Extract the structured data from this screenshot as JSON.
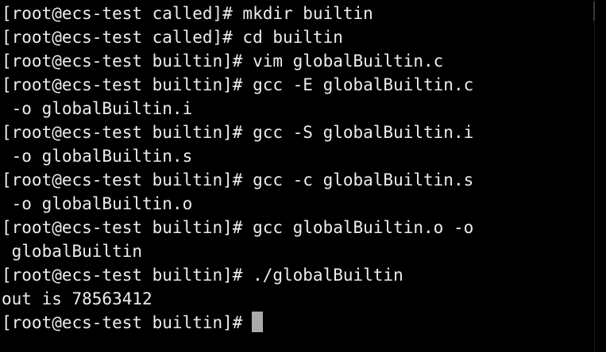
{
  "terminal": {
    "lines": [
      "[root@ecs-test called]# mkdir builtin",
      "[root@ecs-test called]# cd builtin",
      "[root@ecs-test builtin]# vim globalBuiltin.c",
      "[root@ecs-test builtin]# gcc -E globalBuiltin.c",
      " -o globalBuiltin.i",
      "[root@ecs-test builtin]# gcc -S globalBuiltin.i",
      " -o globalBuiltin.s",
      "[root@ecs-test builtin]# gcc -c globalBuiltin.s",
      " -o globalBuiltin.o",
      "[root@ecs-test builtin]# gcc globalBuiltin.o -o",
      " globalBuiltin",
      "[root@ecs-test builtin]# ./globalBuiltin",
      "out is 78563412"
    ],
    "prompt": "[root@ecs-test builtin]#"
  },
  "colors": {
    "background": "#000000",
    "text": "#ededed",
    "cursor": "#a9a9a9"
  }
}
